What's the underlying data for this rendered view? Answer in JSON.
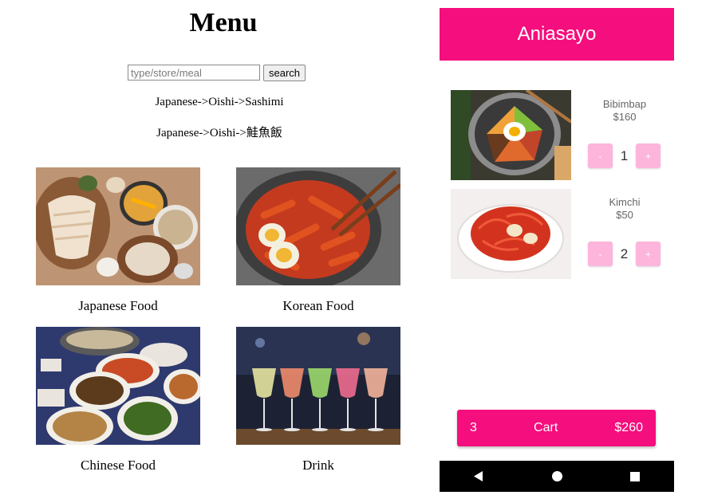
{
  "menu": {
    "title": "Menu",
    "search": {
      "placeholder": "type/store/meal",
      "button_label": "search"
    },
    "history": [
      "Japanese->Oishi->Sashimi",
      "Japanese->Oishi->鮭魚飯"
    ],
    "categories": [
      {
        "label": "Japanese Food"
      },
      {
        "label": "Korean Food"
      },
      {
        "label": "Chinese Food"
      },
      {
        "label": "Drink"
      }
    ]
  },
  "app": {
    "title": "Aniasayo",
    "brand_color": "#f50e7d",
    "button_tint": "#fdb5dc",
    "items": [
      {
        "name": "Bibimbap",
        "price": "$160",
        "qty": "1",
        "minus": "-",
        "plus": "+"
      },
      {
        "name": "Kimchi",
        "price": "$50",
        "qty": "2",
        "minus": "-",
        "plus": "+"
      }
    ],
    "cart": {
      "count": "3",
      "label": "Cart",
      "total": "$260"
    },
    "nav": [
      "back-icon",
      "home-icon",
      "recents-icon"
    ]
  }
}
